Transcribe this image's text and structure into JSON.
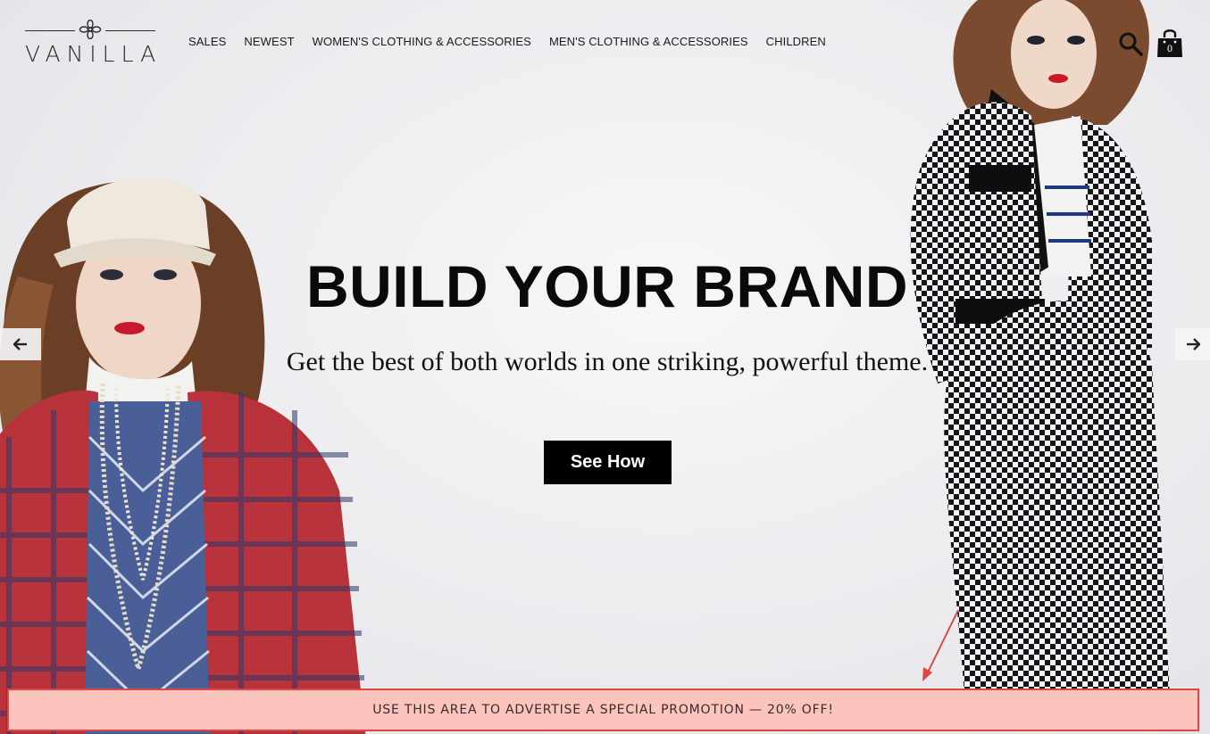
{
  "brand": {
    "name": "VANILLA"
  },
  "nav": {
    "items": [
      {
        "label": "SALES"
      },
      {
        "label": "NEWEST"
      },
      {
        "label": "WOMEN'S CLOTHING & ACCESSORIES"
      },
      {
        "label": "MEN'S CLOTHING & ACCESSORIES"
      },
      {
        "label": "CHILDREN"
      }
    ]
  },
  "header_icons": {
    "search": "search-icon",
    "cart": "shopping-bag-icon",
    "cart_count": "0"
  },
  "hero": {
    "title": "BUILD YOUR BRAND",
    "subtitle": "Get the best of both worlds in one striking, powerful theme.",
    "cta_label": "See How",
    "prev_icon": "arrow-left-icon",
    "next_icon": "arrow-right-icon"
  },
  "promo": {
    "text": "USE THIS AREA TO ADVERTISE A SPECIAL PROMOTION — 20% OFF!"
  },
  "colors": {
    "promo_background": "#fbc4bd",
    "promo_border": "#e04444",
    "cta_background": "#000000",
    "annotation": "#e04444"
  }
}
